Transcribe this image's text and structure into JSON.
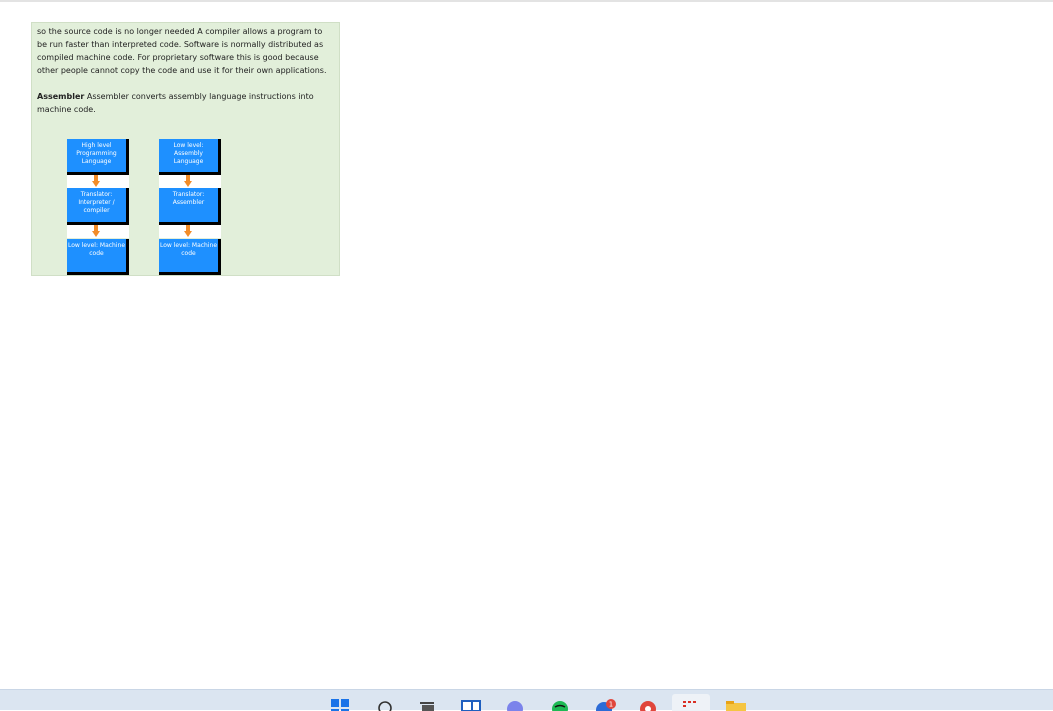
{
  "note": {
    "paragraph1": "so the source code is no longer needed A compiler allows a program to be run faster than interpreted code.  Software is normally distributed as compiled machine code.  For proprietary software this is good because other people cannot copy the code and use it for their own applications.",
    "paragraph2_bold": "Assembler",
    "paragraph2_rest": " Assembler converts assembly language instructions into machine code."
  },
  "diagram": {
    "left_column": {
      "top_box": "High level Programming Language",
      "middle_box": "Translator: Interpreter / compiler",
      "bottom_box": "Low level: Machine code"
    },
    "right_column": {
      "top_box": "Low level: Assembly Language",
      "middle_box": "Translator: Assembler",
      "bottom_box": "Low level: Machine code"
    },
    "box_color": "#1e90ff",
    "arrow_color": "#f28c28"
  },
  "taskbar": {
    "background": "#dbe5f1",
    "icons": [
      {
        "name": "windows-start-icon"
      },
      {
        "name": "search-icon"
      },
      {
        "name": "task-view-icon"
      },
      {
        "name": "widgets-icon"
      },
      {
        "name": "teams-chat-icon"
      },
      {
        "name": "spotify-icon"
      },
      {
        "name": "messenger-icon",
        "badge": "1"
      },
      {
        "name": "chrome-icon"
      },
      {
        "name": "app-icon"
      },
      {
        "name": "file-explorer-icon"
      }
    ]
  }
}
